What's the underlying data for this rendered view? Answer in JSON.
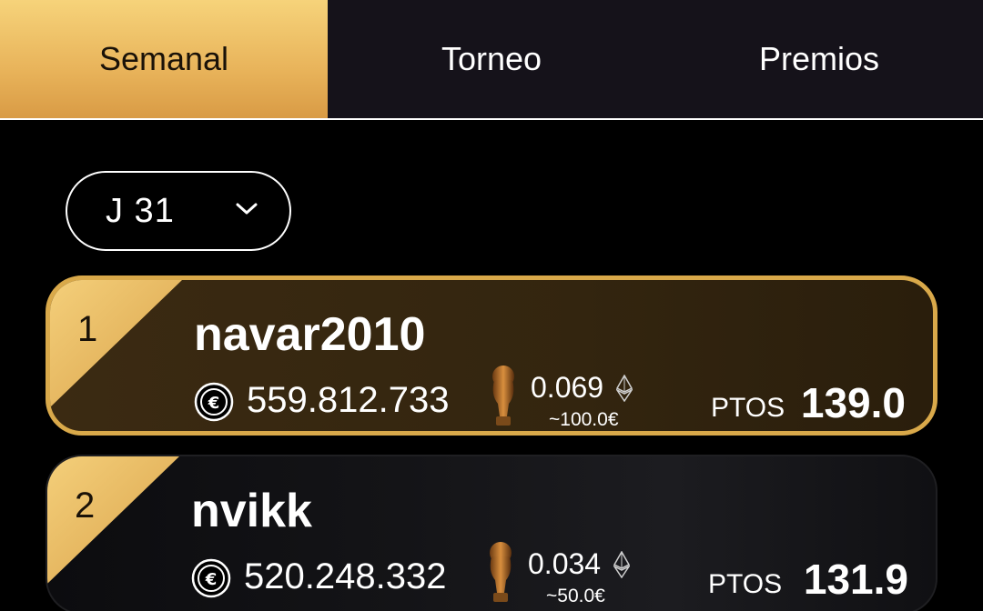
{
  "tabs": [
    {
      "label": "Semanal",
      "active": true
    },
    {
      "label": "Torneo",
      "active": false
    },
    {
      "label": "Premios",
      "active": false
    }
  ],
  "round_selector": {
    "value": "J 31"
  },
  "leaderboard": [
    {
      "rank": "1",
      "name": "navar2010",
      "coins": "559.812.733",
      "eth": "0.069",
      "eur": "~100.0€",
      "ptos_label": "PTOS",
      "ptos": "139.0"
    },
    {
      "rank": "2",
      "name": "nvikk",
      "coins": "520.248.332",
      "eth": "0.034",
      "eur": "~50.0€",
      "ptos_label": "PTOS",
      "ptos": "131.9"
    }
  ],
  "colors": {
    "gold": "#e8b35a",
    "background": "#000000",
    "tabbar": "#15121a"
  },
  "icons": {
    "coin": "euro-coin-icon",
    "trophy": "trophy-icon",
    "eth": "ethereum-icon",
    "chevron": "chevron-down-icon"
  }
}
